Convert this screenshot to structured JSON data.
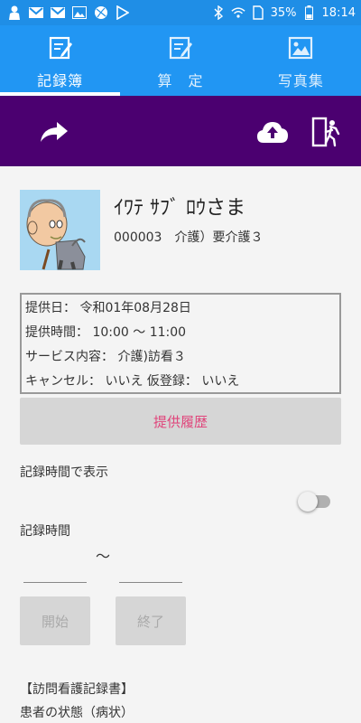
{
  "statusbar": {
    "battery": "35%",
    "time": "18:14",
    "icons": [
      "person-icon",
      "gmail-icon",
      "gmail-icon",
      "image-icon",
      "ball-icon",
      "play-icon",
      "bluetooth-icon",
      "wifi-icon",
      "sim-icon",
      "battery-icon"
    ]
  },
  "tabs": [
    {
      "label": "記録簿",
      "icon": "edit-note-icon",
      "active": true
    },
    {
      "label": "算　定",
      "icon": "edit-note-icon",
      "active": false
    },
    {
      "label": "写真集",
      "icon": "photo-icon",
      "active": false
    }
  ],
  "toolbar": {
    "share_icon": "share-arrow-icon",
    "upload_icon": "cloud-upload-icon",
    "exit_icon": "exit-door-icon"
  },
  "patient": {
    "name": "ｲﾜﾃ ｻﾌﾞ ﾛｳさま",
    "info": "000003　介護）要介護３"
  },
  "service": {
    "date": "提供日：  令和01年08月28日",
    "time": "提供時間：  10:00  〜  11:00",
    "content": "サービス内容：  介護)訪看３",
    "cancel": "キャンセル：  いいえ  仮登録：  いいえ"
  },
  "history_button": "提供履歴",
  "record_time_display_label": "記録時間で表示",
  "record_time_label": "記録時間",
  "tilde": "〜",
  "start_button": "開始",
  "end_button": "終了",
  "report": {
    "header": "【訪問看護記録書】",
    "sub": "患者の状態（病状）"
  },
  "colors": {
    "status_bar": "#1f8ee6",
    "tab_bar": "#2196f3",
    "toolbar": "#4b0070",
    "history_text": "#e0457b"
  }
}
